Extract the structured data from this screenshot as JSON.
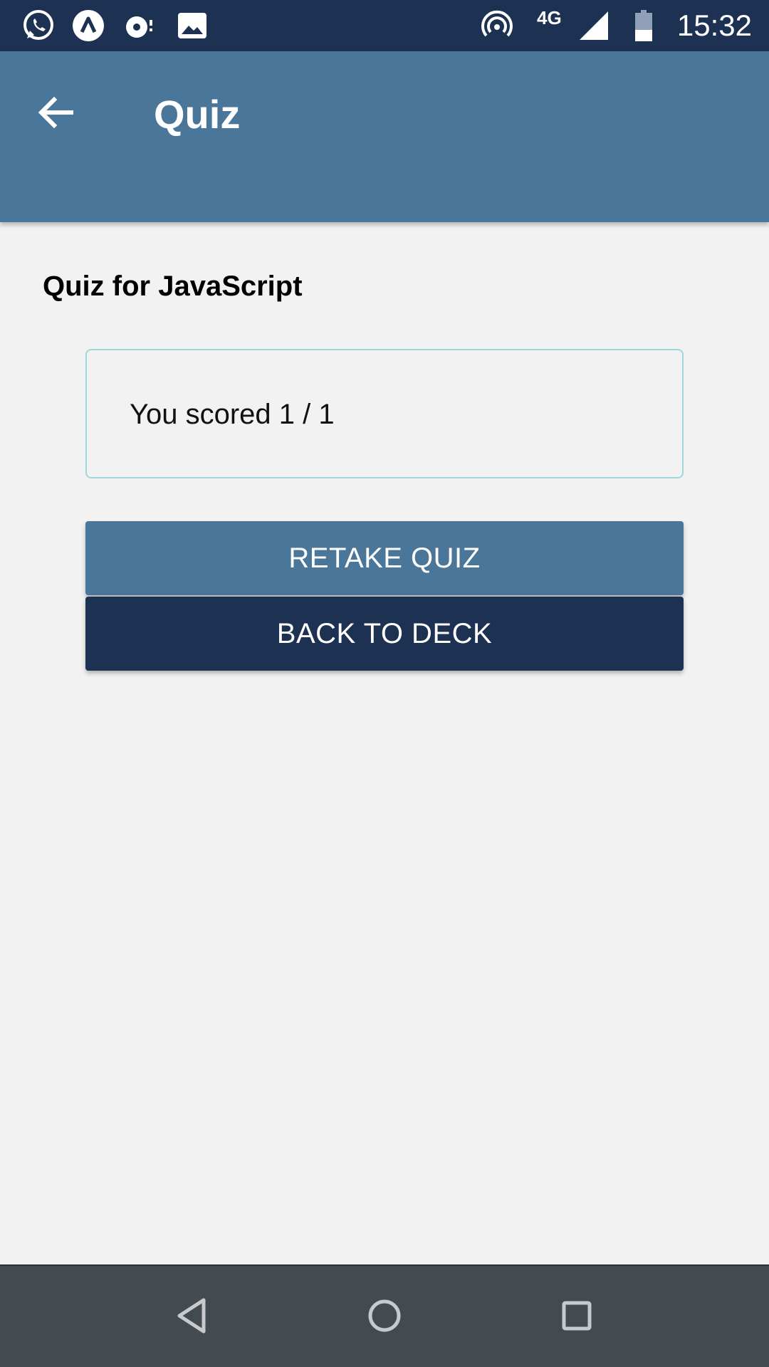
{
  "status_bar": {
    "time": "15:32",
    "network": "4G",
    "icons": [
      "whatsapp-icon",
      "expo-icon",
      "podcast-icon",
      "image-icon",
      "hotspot-icon",
      "signal-icon",
      "battery-icon"
    ]
  },
  "header": {
    "title": "Quiz",
    "back_icon": "arrow-left-icon"
  },
  "main": {
    "deck_title": "Quiz for JavaScript",
    "score_text": "You scored 1 / 1",
    "retake_label": "RETAKE QUIZ",
    "back_to_deck_label": "BACK TO DECK"
  },
  "nav_bar": {
    "icons": [
      "back-triangle-icon",
      "home-circle-icon",
      "recents-square-icon"
    ]
  },
  "colors": {
    "status_bar": "#1d3152",
    "header": "#4a7699",
    "primary_button": "#4a7699",
    "secondary_button": "#1d3152",
    "card_border": "#a3d6d8",
    "background": "#f2f2f2",
    "nav_bar": "#434a50"
  }
}
